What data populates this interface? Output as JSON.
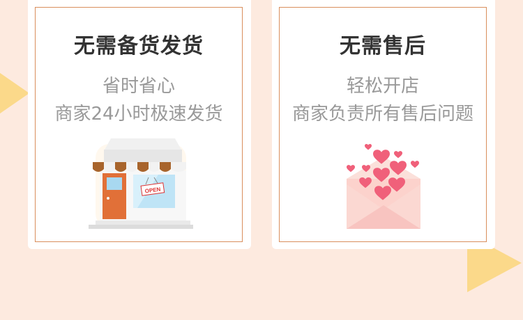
{
  "cards": [
    {
      "title": "无需备货发货",
      "line1": "省时省心",
      "line2": "商家24小时极速发货",
      "illustration": "shop-storefront-icon",
      "sign_text": "OPEN"
    },
    {
      "title": "无需售后",
      "line1": "轻松开店",
      "line2": "商家负责所有售后问题",
      "illustration": "envelope-hearts-icon"
    }
  ],
  "colors": {
    "background": "#fdeadf",
    "card_border": "#d98e5c",
    "title": "#333333",
    "subtitle": "#999999",
    "triangle": "#fbd98a",
    "heart": "#f0607a"
  }
}
